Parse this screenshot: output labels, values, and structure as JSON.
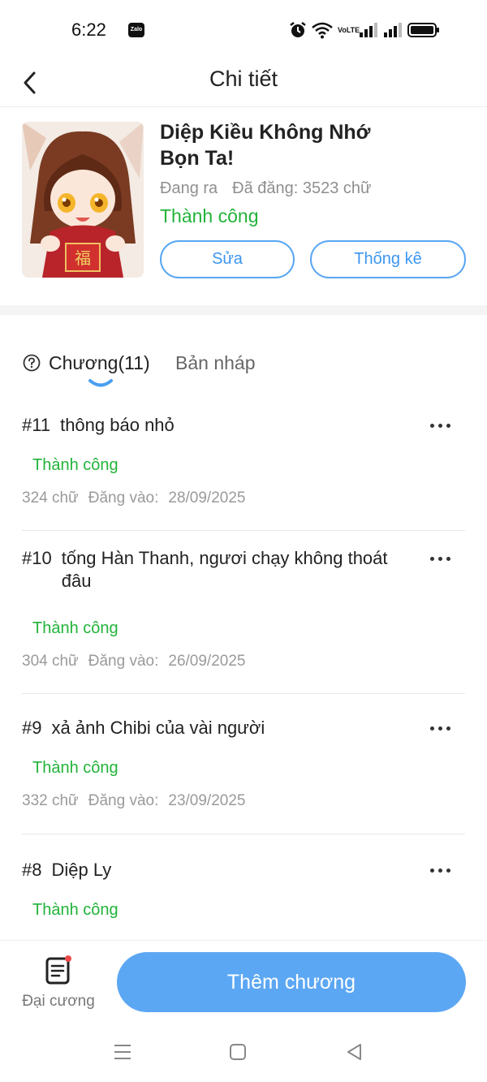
{
  "status_bar": {
    "time": "6:22",
    "notification_app": "Zalo",
    "network_label": "VoLTE",
    "icons": [
      "alarm-icon",
      "wifi-icon",
      "volte-icon",
      "signal-icon",
      "signal-icon",
      "battery-icon"
    ]
  },
  "header": {
    "title": "Chi tiết",
    "back_icon": "chevron-left-icon"
  },
  "book": {
    "title": "Diệp Kiều Không Nhớ Bọn Ta!",
    "state": "Đang ra",
    "word_count_text": "Đã đăng: 3523 chữ",
    "status": "Thành công",
    "edit_label": "Sửa",
    "stats_label": "Thống kê"
  },
  "tabs": {
    "chapters_label": "Chương(11)",
    "drafts_label": "Bản nháp",
    "active": "chapters"
  },
  "chapters": [
    {
      "number": "#11",
      "title": "thông báo nhỏ",
      "status": "Thành công",
      "words": "324 chữ",
      "posted_label": "Đăng vào:",
      "date": "28/09/2025"
    },
    {
      "number": "#10",
      "title": "tống Hàn Thanh, ngươi chạy không thoát đâu",
      "status": "Thành công",
      "words": "304 chữ",
      "posted_label": "Đăng vào:",
      "date": "26/09/2025"
    },
    {
      "number": "#9",
      "title": "xả ảnh Chibi của vài người",
      "status": "Thành công",
      "words": "332 chữ",
      "posted_label": "Đăng vào:",
      "date": "23/09/2025"
    },
    {
      "number": "#8",
      "title": "Diệp Ly",
      "status": "Thành công",
      "words": "",
      "posted_label": "",
      "date": ""
    }
  ],
  "bottom_bar": {
    "outline_label": "Đại cương",
    "add_chapter_label": "Thêm chương"
  },
  "colors": {
    "accent_blue": "#5ca7f3",
    "success_green": "#22b33a",
    "muted_text": "#9a9a9a"
  }
}
